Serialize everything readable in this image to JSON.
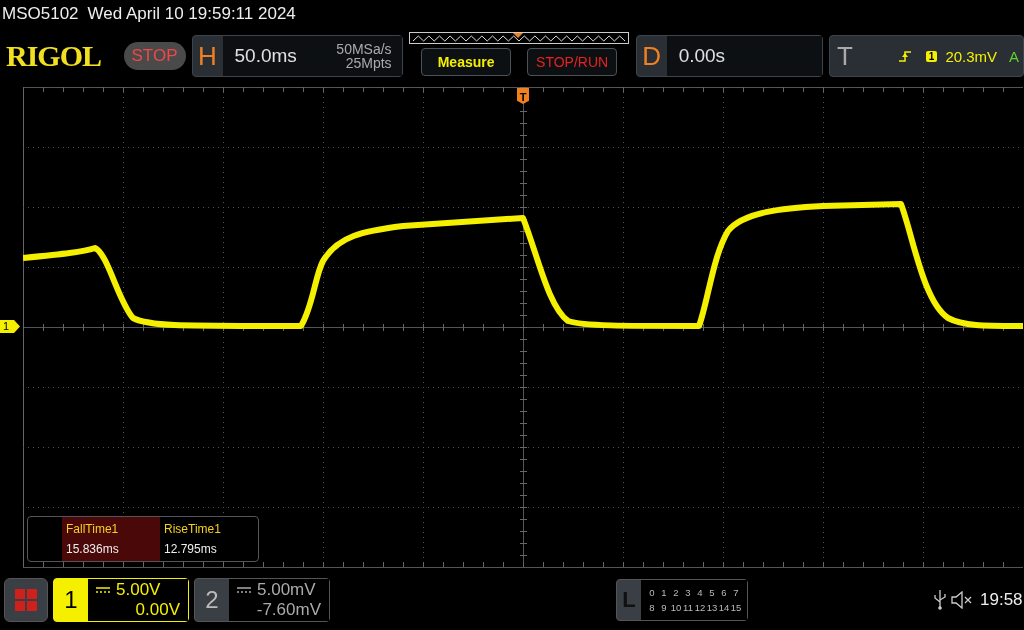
{
  "status": {
    "model": "MSO5102",
    "datetime": "Wed April 10 19:59:11 2024"
  },
  "toolbar": {
    "logo": "RIGOL",
    "run_state": "STOP",
    "horizontal": {
      "label": "H",
      "timebase": "50.0ms",
      "sample_rate": "50MSa/s",
      "memory_depth": "25Mpts"
    },
    "buttons": [
      "Measure",
      "STOP/RUN"
    ],
    "delay": {
      "label": "D",
      "value": "0.00s"
    },
    "trigger": {
      "label": "T",
      "source": "1",
      "level": "20.3mV",
      "mode": "A"
    }
  },
  "grid": {
    "trigger_marker": "T",
    "channel_marker": "1"
  },
  "measurements": [
    {
      "name": "FallTime1",
      "value": "15.836ms",
      "selected": true
    },
    {
      "name": "RiseTime1",
      "value": "12.795ms",
      "selected": false
    }
  ],
  "channels": [
    {
      "number": "1",
      "scale": "5.00V",
      "offset": "0.00V",
      "active": true
    },
    {
      "number": "2",
      "scale": "5.00mV",
      "offset": "-7.60mV",
      "active": false
    }
  ],
  "logic": {
    "label": "L",
    "rows": [
      [
        "0",
        "1",
        "2",
        "3",
        "4",
        "5",
        "6",
        "7"
      ],
      [
        "8",
        "9",
        "10",
        "11",
        "12",
        "13",
        "14",
        "15"
      ]
    ]
  },
  "system": {
    "time": "19:58"
  }
}
